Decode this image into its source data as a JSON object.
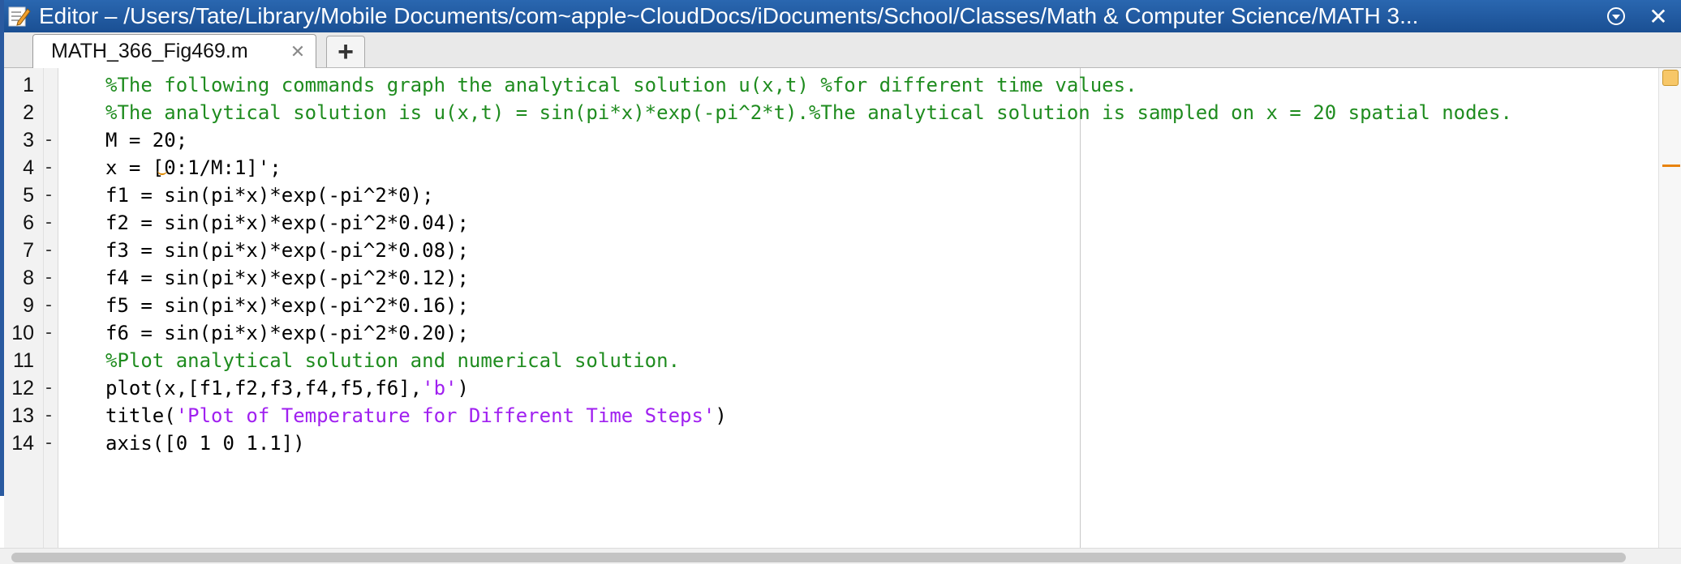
{
  "window": {
    "title": "Editor – /Users/Tate/Library/Mobile Documents/com~apple~CloudDocs/iDocuments/School/Classes/Math & Computer Science/MATH 3...",
    "menu_icon": "chevron-circle-down-icon",
    "close_label": "✕"
  },
  "tabs": [
    {
      "label": "MATH_366_Fig469.m",
      "close_icon": "✕"
    }
  ],
  "add_tab_label": "+",
  "editor": {
    "lines": [
      {
        "number": "1",
        "marker": "",
        "segments": [
          {
            "type": "comment",
            "text": "%The following commands graph the analytical solution u(x,t) %for different time values."
          }
        ]
      },
      {
        "number": "2",
        "marker": "",
        "segments": [
          {
            "type": "comment",
            "text": "%The analytical solution is u(x,t) = sin(pi*x)*exp(-pi^2*t).%The analytical solution is sampled on x = 20 spatial nodes."
          }
        ]
      },
      {
        "number": "3",
        "marker": "-",
        "segments": [
          {
            "type": "code",
            "text": "M = 20;"
          }
        ]
      },
      {
        "number": "4",
        "marker": "-",
        "segments": [
          {
            "type": "code",
            "text": "x = [0:1/M:1]';"
          }
        ]
      },
      {
        "number": "5",
        "marker": "-",
        "segments": [
          {
            "type": "code",
            "text": "f1 = sin(pi*x)*exp(-pi^2*0);"
          }
        ]
      },
      {
        "number": "6",
        "marker": "-",
        "segments": [
          {
            "type": "code",
            "text": "f2 = sin(pi*x)*exp(-pi^2*0.04);"
          }
        ]
      },
      {
        "number": "7",
        "marker": "-",
        "segments": [
          {
            "type": "code",
            "text": "f3 = sin(pi*x)*exp(-pi^2*0.08);"
          }
        ]
      },
      {
        "number": "8",
        "marker": "-",
        "segments": [
          {
            "type": "code",
            "text": "f4 = sin(pi*x)*exp(-pi^2*0.12);"
          }
        ]
      },
      {
        "number": "9",
        "marker": "-",
        "segments": [
          {
            "type": "code",
            "text": "f5 = sin(pi*x)*exp(-pi^2*0.16);"
          }
        ]
      },
      {
        "number": "10",
        "marker": "-",
        "segments": [
          {
            "type": "code",
            "text": "f6 = sin(pi*x)*exp(-pi^2*0.20);"
          }
        ]
      },
      {
        "number": "11",
        "marker": "",
        "segments": [
          {
            "type": "comment",
            "text": "%Plot analytical solution and numerical solution."
          }
        ]
      },
      {
        "number": "12",
        "marker": "-",
        "segments": [
          {
            "type": "code",
            "text": "plot(x,[f1,f2,f3,f4,f5,f6],"
          },
          {
            "type": "string",
            "text": "'b'"
          },
          {
            "type": "code",
            "text": ")"
          }
        ]
      },
      {
        "number": "13",
        "marker": "-",
        "segments": [
          {
            "type": "code",
            "text": "title("
          },
          {
            "type": "string",
            "text": "'Plot of Temperature for Different Time Steps'"
          },
          {
            "type": "code",
            "text": ")"
          }
        ]
      },
      {
        "number": "14",
        "marker": "-",
        "segments": [
          {
            "type": "code",
            "text": "axis([0 1 0 1.1])"
          }
        ]
      }
    ]
  },
  "colors": {
    "titlebar": "#1f5aa0",
    "comment": "#1f8c1f",
    "string": "#a020f0",
    "warning_marker": "#e8830c"
  }
}
